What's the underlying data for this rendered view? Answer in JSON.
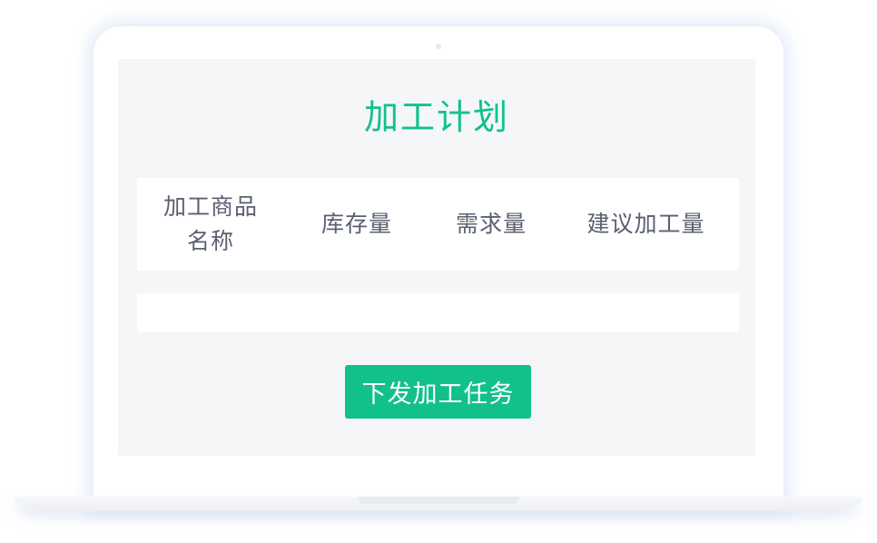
{
  "title": "加工计划",
  "table": {
    "headers": [
      {
        "line1": "加工商品",
        "line2": "名称"
      },
      {
        "line1": "库存量"
      },
      {
        "line1": "需求量"
      },
      {
        "line1": "建议加工量"
      }
    ],
    "rows": []
  },
  "action_button": "下发加工任务",
  "colors": {
    "accent": "#12c18a",
    "screen_bg": "#f5f6f8",
    "header_text": "#5a6070"
  }
}
